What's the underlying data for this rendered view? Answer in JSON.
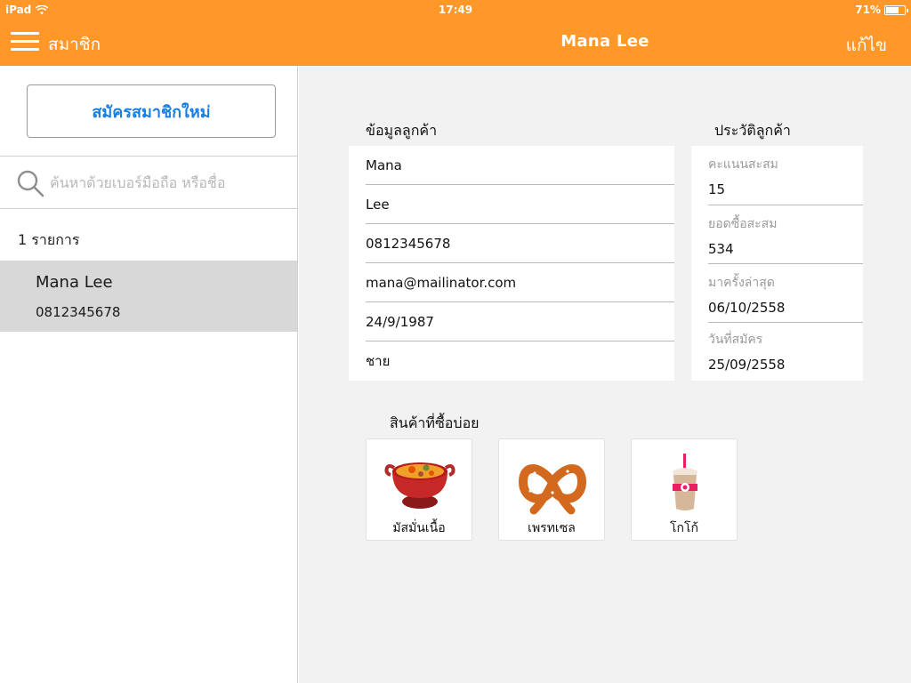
{
  "status_bar": {
    "device": "iPad",
    "time": "17:49",
    "battery": "71%",
    "battery_level": 0.71
  },
  "header": {
    "left_title": "สมาชิก",
    "title": "Mana Lee",
    "edit_label": "แก้ไข"
  },
  "sidebar": {
    "new_member_label": "สมัครสมาชิกใหม่",
    "search_placeholder": "ค้นหาด้วยเบอร์มือถือ หรือชื่อ",
    "result_count": "1 รายการ",
    "members": [
      {
        "name": "Mana Lee",
        "phone": "0812345678"
      }
    ]
  },
  "customer_info": {
    "title": "ข้อมูลลูกค้า",
    "first_name": "Mana",
    "last_name": "Lee",
    "phone": "0812345678",
    "email": "mana@mailinator.com",
    "birthdate": "24/9/1987",
    "gender": "ชาย"
  },
  "customer_history": {
    "title": "ประวัติลูกค้า",
    "items": [
      {
        "label": "คะแนนสะสม",
        "value": "15"
      },
      {
        "label": "ยอดซื้อสะสม",
        "value": "534"
      },
      {
        "label": "มาครั้งล่าสุด",
        "value": "06/10/2558"
      },
      {
        "label": "วันที่สมัคร",
        "value": "25/09/2558"
      }
    ]
  },
  "frequent_products": {
    "title": "สินค้าที่ซื้อบ่อย",
    "items": [
      {
        "label": "มัสมั่นเนื้อ",
        "icon": "curry-pot-icon"
      },
      {
        "label": "เพรทเซล",
        "icon": "pretzel-icon"
      },
      {
        "label": "โกโก้",
        "icon": "iced-cocoa-icon"
      }
    ]
  },
  "colors": {
    "accent": "#ff9829",
    "link": "#1a7fe0",
    "selected_row": "#d8d8d8",
    "panel_bg": "#f2f2f2"
  }
}
